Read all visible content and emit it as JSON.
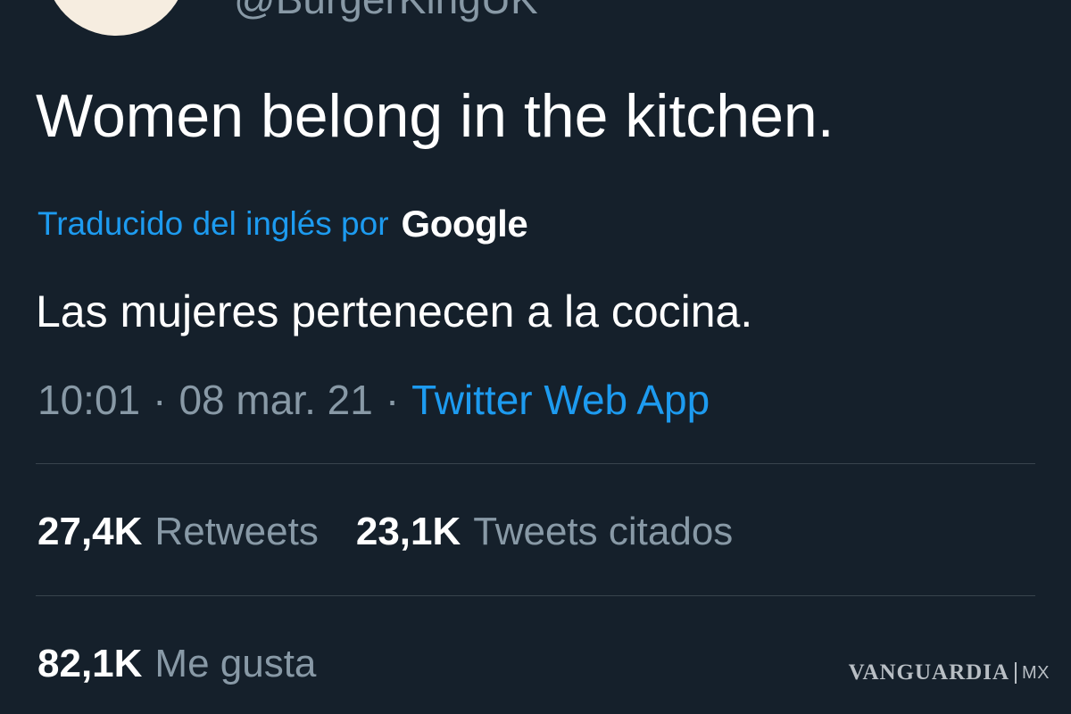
{
  "tweet": {
    "handle": "@BurgerKingUK",
    "text": "Women belong in the kitchen.",
    "translation": {
      "label": "Traducido del inglés por",
      "provider": "Google",
      "text": "Las mujeres pertenecen a la cocina."
    },
    "meta": {
      "time": "10:01",
      "date": "08 mar. 21",
      "source": "Twitter Web App",
      "separator": "·"
    },
    "stats": {
      "retweets": {
        "count": "27,4K",
        "label": "Retweets"
      },
      "quotes": {
        "count": "23,1K",
        "label": "Tweets citados"
      },
      "likes": {
        "count": "82,1K",
        "label": "Me gusta"
      }
    }
  },
  "watermark": {
    "brand": "VANGUARDIA",
    "country": "MX"
  },
  "colors": {
    "background": "#15202b",
    "text_primary": "#ffffff",
    "text_muted": "#8899a6",
    "link_blue": "#1d9bf0",
    "divider": "#38444d",
    "avatar_orange": "#f28a2a"
  }
}
